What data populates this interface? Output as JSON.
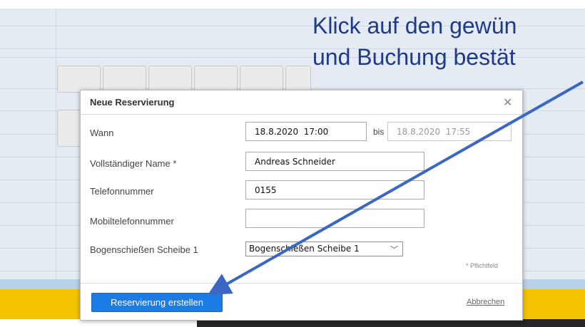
{
  "callout": {
    "line1": "Klick auf den gewün",
    "line2": "und Buchung bestät",
    "color": "#1f3a8a"
  },
  "dialog": {
    "title": "Neue Reservierung",
    "close_icon": "close-icon",
    "fields": {
      "when_label": "Wann",
      "start_value": "18.8.2020  17:00",
      "bis_label": "bis",
      "end_value": "18.8.2020  17:55",
      "name_label": "Vollständiger Name *",
      "name_value": "Andreas Schneider",
      "phone_label": "Telefonnummer",
      "phone_value": "0155",
      "mobile_label": "Mobiltelefonnummer",
      "mobile_value": "",
      "target_label": "Bogenschießen Scheibe 1",
      "target_selected": "Bogenschießen Scheibe 1"
    },
    "required_note": "* Pflichtfeld",
    "submit_label": "Reservierung erstellen",
    "cancel_label": "Abbrechen"
  },
  "colors": {
    "primary_button": "#1c7ce6",
    "annotation_arrow": "#3a66c4",
    "footer_band": "#f5c400"
  }
}
